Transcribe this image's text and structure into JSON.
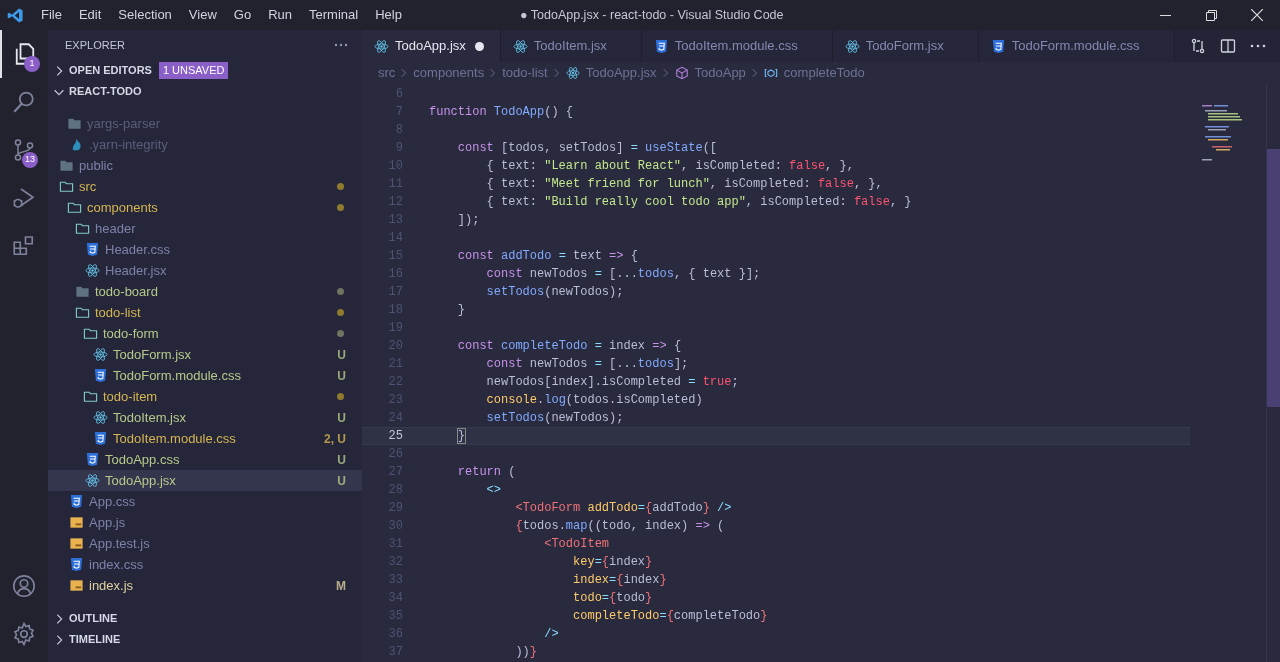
{
  "window": {
    "title": "● TodoApp.jsx - react-todo - Visual Studio Code"
  },
  "menu": [
    "File",
    "Edit",
    "Selection",
    "View",
    "Go",
    "Run",
    "Terminal",
    "Help"
  ],
  "activity_bar": [
    {
      "kind": "files",
      "selected": true,
      "badge": "1"
    },
    {
      "kind": "search",
      "selected": false
    },
    {
      "kind": "source-control",
      "selected": false,
      "badge": "13"
    },
    {
      "kind": "debug",
      "selected": false
    },
    {
      "kind": "extensions",
      "selected": false
    }
  ],
  "activity_bottom": [
    {
      "kind": "account"
    },
    {
      "kind": "settings"
    }
  ],
  "sidebar": {
    "title": "EXPLORER",
    "sections": [
      {
        "label": "OPEN EDITORS",
        "expanded": false,
        "badge": "1 UNSAVED"
      },
      {
        "label": "REACT-TODO",
        "expanded": true
      }
    ],
    "tree": [
      {
        "name": "yargs-parser",
        "kind": "folder",
        "expanded": false,
        "color": "#5a5e7a",
        "selected": false
      },
      {
        "name": ".yarn-integrity",
        "kind": "yarn",
        "color": "#5a5e7a",
        "selected": false
      },
      {
        "name": "public",
        "kind": "folder",
        "expanded": false,
        "color": "#7d82a8",
        "selected": false
      },
      {
        "name": "src",
        "kind": "folder",
        "expanded": true,
        "color": "#d5b552",
        "dot": {
          "color": "#8f7a2e"
        },
        "selected": false,
        "children": [
          {
            "name": "components",
            "kind": "folder",
            "expanded": true,
            "color": "#d5b552",
            "dot": {
              "color": "#8f7a2e"
            },
            "selected": false,
            "children": [
              {
                "name": "header",
                "kind": "folder",
                "expanded": true,
                "color": "#7d82a8",
                "selected": false,
                "children": [
                  {
                    "name": "Header.css",
                    "kind": "css",
                    "color": "#7d82a8",
                    "selected": false
                  },
                  {
                    "name": "Header.jsx",
                    "kind": "jsx",
                    "color": "#7d82a8",
                    "selected": false
                  }
                ]
              },
              {
                "name": "todo-board",
                "kind": "folder",
                "expanded": false,
                "color": "#b7c98a",
                "dot": {
                  "color": "#6f735f"
                },
                "selected": false
              },
              {
                "name": "todo-list",
                "kind": "folder",
                "expanded": true,
                "color": "#d5b552",
                "dot": {
                  "color": "#8f7a2e"
                },
                "selected": false,
                "children": [
                  {
                    "name": "todo-form",
                    "kind": "folder",
                    "expanded": true,
                    "color": "#b7c98a",
                    "dot": {
                      "color": "#6f735f"
                    },
                    "selected": false,
                    "children": [
                      {
                        "name": "TodoForm.jsx",
                        "kind": "jsx",
                        "color": "#b7c98a",
                        "badge": "U",
                        "selected": false
                      },
                      {
                        "name": "TodoForm.module.css",
                        "kind": "css",
                        "color": "#b7c98a",
                        "badge": "U",
                        "selected": false
                      }
                    ]
                  },
                  {
                    "name": "todo-item",
                    "kind": "folder",
                    "expanded": true,
                    "color": "#d5b552",
                    "dot": {
                      "color": "#8f7a2e"
                    },
                    "selected": false,
                    "children": [
                      {
                        "name": "TodoItem.jsx",
                        "kind": "jsx",
                        "color": "#b7c98a",
                        "badge": "U",
                        "selected": false
                      },
                      {
                        "name": "TodoItem.module.css",
                        "kind": "css",
                        "color": "#d5b552",
                        "badge": "2, U",
                        "selected": false
                      }
                    ]
                  },
                  {
                    "name": "TodoApp.css",
                    "kind": "css",
                    "color": "#b7c98a",
                    "badge": "U",
                    "selected": false
                  },
                  {
                    "name": "TodoApp.jsx",
                    "kind": "jsx",
                    "color": "#b7c98a",
                    "badge": "U",
                    "selected": true
                  }
                ]
              }
            ]
          },
          {
            "name": "App.css",
            "kind": "css",
            "color": "#7d82a8",
            "selected": false
          },
          {
            "name": "App.js",
            "kind": "js",
            "color": "#7d82a8",
            "selected": false
          },
          {
            "name": "App.test.js",
            "kind": "js",
            "color": "#7d82a8",
            "selected": false
          },
          {
            "name": "index.css",
            "kind": "css",
            "color": "#7d82a8",
            "selected": false
          },
          {
            "name": "index.js",
            "kind": "js",
            "color": "#e0cfa0",
            "badge": "M",
            "selected": false
          }
        ]
      }
    ],
    "bottom_sections": [
      {
        "label": "OUTLINE",
        "expanded": false
      },
      {
        "label": "TIMELINE",
        "expanded": false
      }
    ]
  },
  "tabs": [
    {
      "label": "TodoApp.jsx",
      "kind": "jsx",
      "selected": true,
      "dirty": true
    },
    {
      "label": "TodoItem.jsx",
      "kind": "jsx",
      "selected": false,
      "dirty": false
    },
    {
      "label": "TodoItem.module.css",
      "kind": "css",
      "selected": false,
      "dirty": false
    },
    {
      "label": "TodoForm.jsx",
      "kind": "jsx",
      "selected": false,
      "dirty": false
    },
    {
      "label": "TodoForm.module.css",
      "kind": "css",
      "selected": false,
      "dirty": false
    }
  ],
  "breadcrumbs": [
    {
      "label": "src",
      "kind": "folder"
    },
    {
      "label": "components",
      "kind": "folder"
    },
    {
      "label": "todo-list",
      "kind": "folder"
    },
    {
      "label": "TodoApp.jsx",
      "kind": "jsx"
    },
    {
      "label": "TodoApp",
      "kind": "component"
    },
    {
      "label": "completeTodo",
      "kind": "variable"
    }
  ],
  "editor": {
    "lines": [
      {
        "number": "6",
        "current": false
      },
      {
        "number": "7",
        "current": false,
        "tokens": [
          {
            "kind": "keyword",
            "text": "function "
          },
          {
            "kind": "function",
            "text": "TodoApp"
          },
          {
            "kind": "plain",
            "text": "() {"
          }
        ]
      },
      {
        "number": "8",
        "current": false
      },
      {
        "number": "9",
        "current": false,
        "tokens": [
          {
            "kind": "keyword",
            "text": "    const "
          },
          {
            "kind": "plain",
            "text": "[todos, setTodos] "
          },
          {
            "kind": "operator",
            "text": "= "
          },
          {
            "kind": "function",
            "text": "useState"
          },
          {
            "kind": "plain",
            "text": "(["
          }
        ]
      },
      {
        "number": "10",
        "current": false,
        "tokens": [
          {
            "kind": "plain",
            "text": "        { text: "
          },
          {
            "kind": "string",
            "text": "\"Learn about React\""
          },
          {
            "kind": "plain",
            "text": ", isCompleted: "
          },
          {
            "kind": "boolean",
            "text": "false"
          },
          {
            "kind": "plain",
            "text": ", },"
          }
        ]
      },
      {
        "number": "11",
        "current": false,
        "tokens": [
          {
            "kind": "plain",
            "text": "        { text: "
          },
          {
            "kind": "string",
            "text": "\"Meet friend for lunch\""
          },
          {
            "kind": "plain",
            "text": ", isCompleted: "
          },
          {
            "kind": "boolean",
            "text": "false"
          },
          {
            "kind": "plain",
            "text": ", },"
          }
        ]
      },
      {
        "number": "12",
        "current": false,
        "tokens": [
          {
            "kind": "plain",
            "text": "        { text: "
          },
          {
            "kind": "string",
            "text": "\"Build really cool todo app\""
          },
          {
            "kind": "plain",
            "text": ", isCompleted: "
          },
          {
            "kind": "boolean",
            "text": "false"
          },
          {
            "kind": "plain",
            "text": ", }"
          }
        ]
      },
      {
        "number": "13",
        "current": false,
        "tokens": [
          {
            "kind": "plain",
            "text": "    ]);"
          }
        ]
      },
      {
        "number": "14",
        "current": false
      },
      {
        "number": "15",
        "current": false,
        "tokens": [
          {
            "kind": "keyword",
            "text": "    const "
          },
          {
            "kind": "function",
            "text": "addTodo "
          },
          {
            "kind": "operator",
            "text": "= "
          },
          {
            "kind": "plain",
            "text": "text "
          },
          {
            "kind": "keyword",
            "text": "=> "
          },
          {
            "kind": "plain",
            "text": "{"
          }
        ]
      },
      {
        "number": "16",
        "current": false,
        "tokens": [
          {
            "kind": "keyword",
            "text": "        const "
          },
          {
            "kind": "plain",
            "text": "newTodos "
          },
          {
            "kind": "operator",
            "text": "= "
          },
          {
            "kind": "plain",
            "text": "[..."
          },
          {
            "kind": "object",
            "text": "todos"
          },
          {
            "kind": "plain",
            "text": ", { text }];"
          }
        ]
      },
      {
        "number": "17",
        "current": false,
        "tokens": [
          {
            "kind": "function",
            "text": "        setTodos"
          },
          {
            "kind": "plain",
            "text": "(newTodos);"
          }
        ]
      },
      {
        "number": "18",
        "current": false,
        "tokens": [
          {
            "kind": "plain",
            "text": "    }"
          }
        ]
      },
      {
        "number": "19",
        "current": false
      },
      {
        "number": "20",
        "current": false,
        "tokens": [
          {
            "kind": "keyword",
            "text": "    const "
          },
          {
            "kind": "function",
            "text": "completeTodo "
          },
          {
            "kind": "operator",
            "text": "= "
          },
          {
            "kind": "plain",
            "text": "index "
          },
          {
            "kind": "keyword",
            "text": "=> "
          },
          {
            "kind": "plain",
            "text": "{"
          }
        ]
      },
      {
        "number": "21",
        "current": false,
        "tokens": [
          {
            "kind": "keyword",
            "text": "        const "
          },
          {
            "kind": "plain",
            "text": "newTodos "
          },
          {
            "kind": "operator",
            "text": "= "
          },
          {
            "kind": "plain",
            "text": "[..."
          },
          {
            "kind": "object",
            "text": "todos"
          },
          {
            "kind": "plain",
            "text": "];"
          }
        ]
      },
      {
        "number": "22",
        "current": false,
        "tokens": [
          {
            "kind": "plain",
            "text": "        newTodos[index].isCompleted "
          },
          {
            "kind": "operator",
            "text": "= "
          },
          {
            "kind": "boolean",
            "text": "true"
          },
          {
            "kind": "plain",
            "text": ";"
          }
        ]
      },
      {
        "number": "23",
        "current": false,
        "tokens": [
          {
            "kind": "attribute",
            "text": "        console"
          },
          {
            "kind": "plain",
            "text": "."
          },
          {
            "kind": "function",
            "text": "log"
          },
          {
            "kind": "plain",
            "text": "(todos.isCompleted)"
          }
        ]
      },
      {
        "number": "24",
        "current": false,
        "tokens": [
          {
            "kind": "function",
            "text": "        setTodos"
          },
          {
            "kind": "plain",
            "text": "(newTodos);"
          }
        ]
      },
      {
        "number": "25",
        "current": true,
        "tokens": [
          {
            "kind": "match",
            "text": "    }"
          }
        ]
      },
      {
        "number": "26",
        "current": false
      },
      {
        "number": "27",
        "current": false,
        "tokens": [
          {
            "kind": "keyword",
            "text": "    return "
          },
          {
            "kind": "plain",
            "text": "("
          }
        ]
      },
      {
        "number": "28",
        "current": false,
        "tokens": [
          {
            "kind": "operator",
            "text": "        <>"
          }
        ]
      },
      {
        "number": "29",
        "current": false,
        "tokens": [
          {
            "kind": "tag",
            "text": "            <TodoForm "
          },
          {
            "kind": "attribute",
            "text": "addTodo"
          },
          {
            "kind": "operator",
            "text": "="
          },
          {
            "kind": "tag",
            "text": "{"
          },
          {
            "kind": "plain",
            "text": "addTodo"
          },
          {
            "kind": "tag",
            "text": "}"
          },
          {
            "kind": "operator",
            "text": " />"
          }
        ]
      },
      {
        "number": "30",
        "current": false,
        "tokens": [
          {
            "kind": "tag",
            "text": "            {"
          },
          {
            "kind": "plain",
            "text": "todos."
          },
          {
            "kind": "function",
            "text": "map"
          },
          {
            "kind": "plain",
            "text": "((todo, index) "
          },
          {
            "kind": "keyword",
            "text": "=> "
          },
          {
            "kind": "plain",
            "text": "("
          }
        ]
      },
      {
        "number": "31",
        "current": false,
        "tokens": [
          {
            "kind": "tag",
            "text": "                <TodoItem"
          }
        ]
      },
      {
        "number": "32",
        "current": false,
        "tokens": [
          {
            "kind": "attribute",
            "text": "                    key"
          },
          {
            "kind": "operator",
            "text": "="
          },
          {
            "kind": "tag",
            "text": "{"
          },
          {
            "kind": "plain",
            "text": "index"
          },
          {
            "kind": "tag",
            "text": "}"
          }
        ]
      },
      {
        "number": "33",
        "current": false,
        "tokens": [
          {
            "kind": "attribute",
            "text": "                    index"
          },
          {
            "kind": "operator",
            "text": "="
          },
          {
            "kind": "tag",
            "text": "{"
          },
          {
            "kind": "plain",
            "text": "index"
          },
          {
            "kind": "tag",
            "text": "}"
          }
        ]
      },
      {
        "number": "34",
        "current": false,
        "tokens": [
          {
            "kind": "attribute",
            "text": "                    todo"
          },
          {
            "kind": "operator",
            "text": "="
          },
          {
            "kind": "tag",
            "text": "{"
          },
          {
            "kind": "plain",
            "text": "todo"
          },
          {
            "kind": "tag",
            "text": "}"
          }
        ]
      },
      {
        "number": "35",
        "current": false,
        "tokens": [
          {
            "kind": "attribute",
            "text": "                    completeTodo"
          },
          {
            "kind": "operator",
            "text": "="
          },
          {
            "kind": "tag",
            "text": "{"
          },
          {
            "kind": "plain",
            "text": "completeTodo"
          },
          {
            "kind": "tag",
            "text": "}"
          }
        ]
      },
      {
        "number": "36",
        "current": false,
        "tokens": [
          {
            "kind": "operator",
            "text": "                />"
          }
        ]
      },
      {
        "number": "37",
        "current": false,
        "tokens": [
          {
            "kind": "plain",
            "text": "            ))"
          },
          {
            "kind": "tag",
            "text": "}"
          }
        ]
      }
    ]
  }
}
